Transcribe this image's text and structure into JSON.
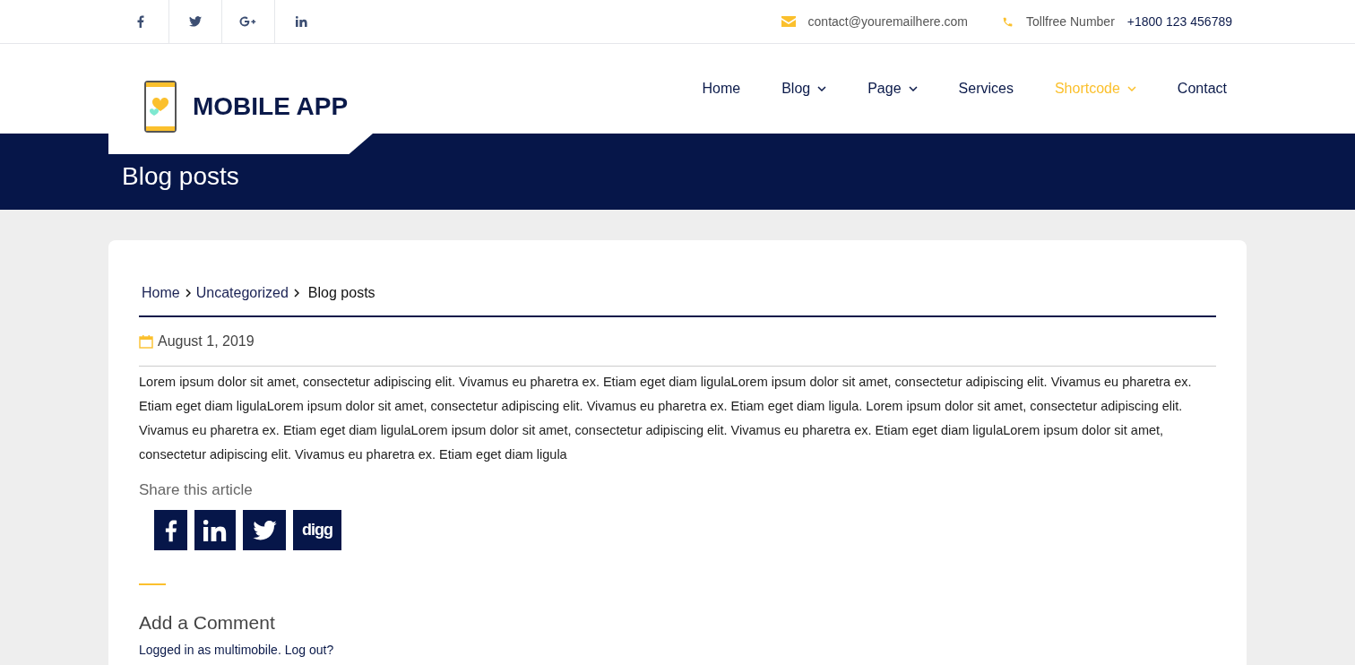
{
  "top_bar": {
    "social": [
      {
        "kind": "facebook"
      },
      {
        "kind": "twitter"
      },
      {
        "kind": "google-plus"
      },
      {
        "kind": "linkedin"
      }
    ],
    "email": "contact@youremailhere.com",
    "phone_label": "Tollfree Number",
    "phone": "+1800 123 456789"
  },
  "logo": {
    "text": "MOBILE APP"
  },
  "nav": [
    {
      "label": "Home",
      "dropdown": false,
      "selected": false
    },
    {
      "label": "Blog",
      "dropdown": true,
      "selected": false
    },
    {
      "label": "Page",
      "dropdown": true,
      "selected": false
    },
    {
      "label": "Services",
      "dropdown": false,
      "selected": false
    },
    {
      "label": "Shortcode",
      "dropdown": true,
      "selected": true
    },
    {
      "label": "Contact",
      "dropdown": false,
      "selected": false
    }
  ],
  "banner": {
    "title": "Blog posts"
  },
  "breadcrumb": [
    {
      "label": "Home",
      "current": false
    },
    {
      "label": "Uncategorized",
      "current": false
    },
    {
      "label": "Blog posts",
      "current": true
    }
  ],
  "post": {
    "date": "August 1, 2019",
    "body": "Lorem ipsum dolor sit amet, consectetur adipiscing elit. Vivamus eu pharetra ex. Etiam eget diam ligulaLorem ipsum dolor sit amet, consectetur adipiscing elit. Vivamus eu pharetra ex. Etiam eget diam ligulaLorem ipsum dolor sit amet, consectetur adipiscing elit. Vivamus eu pharetra ex. Etiam eget diam ligula. Lorem ipsum dolor sit amet, consectetur adipiscing elit. Vivamus eu pharetra ex. Etiam eget diam ligulaLorem ipsum dolor sit amet, consectetur adipiscing elit. Vivamus eu pharetra ex. Etiam eget diam ligulaLorem ipsum dolor sit amet, consectetur adipiscing elit. Vivamus eu pharetra ex. Etiam eget diam ligula"
  },
  "share": {
    "title": "Share this article",
    "buttons": [
      {
        "kind": "facebook"
      },
      {
        "kind": "linkedin"
      },
      {
        "kind": "twitter"
      },
      {
        "kind": "digg",
        "label": "digg"
      }
    ]
  },
  "comments": {
    "title": "Add a Comment",
    "logged_in_prefix": "Logged in as ",
    "user": "multimobile",
    "separator": ". ",
    "logout": "Log out?"
  }
}
